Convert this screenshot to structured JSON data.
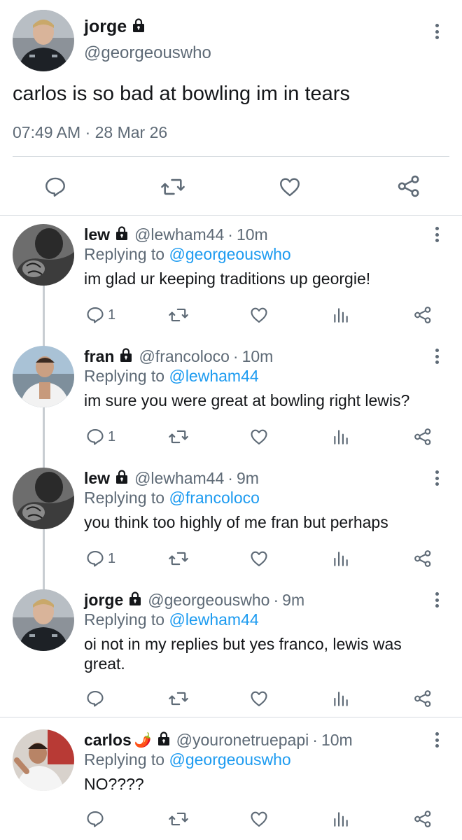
{
  "main_tweet": {
    "name": "jorge",
    "handle": "@georgeouswho",
    "text": "carlos is so bad at bowling im in tears",
    "timestamp": "07:49 AM · 28 Mar 26"
  },
  "replies": [
    {
      "name": "lew",
      "handle": "@lewham44",
      "separator": "·",
      "time": "10m",
      "replying_prefix": "Replying to",
      "replying_to": "@georgeouswho",
      "text": "im glad ur keeping traditions up georgie!",
      "reply_count": "1"
    },
    {
      "name": "fran",
      "handle": "@francoloco",
      "separator": "·",
      "time": "10m",
      "replying_prefix": "Replying to",
      "replying_to": "@lewham44",
      "text": "im sure you were great at bowling right lewis?",
      "reply_count": "1"
    },
    {
      "name": "lew",
      "handle": "@lewham44",
      "separator": "·",
      "time": "9m",
      "replying_prefix": "Replying to",
      "replying_to": "@francoloco",
      "text": "you think too highly of me fran but perhaps",
      "reply_count": "1"
    },
    {
      "name": "jorge",
      "handle": "@georgeouswho",
      "separator": "·",
      "time": "9m",
      "replying_prefix": "Replying to",
      "replying_to": "@lewham44",
      "text": "oi not in my replies but yes franco, lewis was great.",
      "reply_count": ""
    },
    {
      "name": "carlos",
      "name_emoji": "🌶️",
      "handle": "@youronetruepapi",
      "separator": "·",
      "time": "10m",
      "replying_prefix": "Replying to",
      "replying_to": "@georgeouswho",
      "text": "NO????",
      "reply_count": ""
    }
  ],
  "colors": {
    "text": "#141619",
    "secondary": "#5e6a76",
    "mention": "#1d9bf0",
    "divider": "#d6dbe0"
  },
  "icons": [
    "lock-icon",
    "more-options-icon",
    "reply-icon",
    "retweet-icon",
    "like-icon",
    "share-icon",
    "analytics-icon"
  ]
}
